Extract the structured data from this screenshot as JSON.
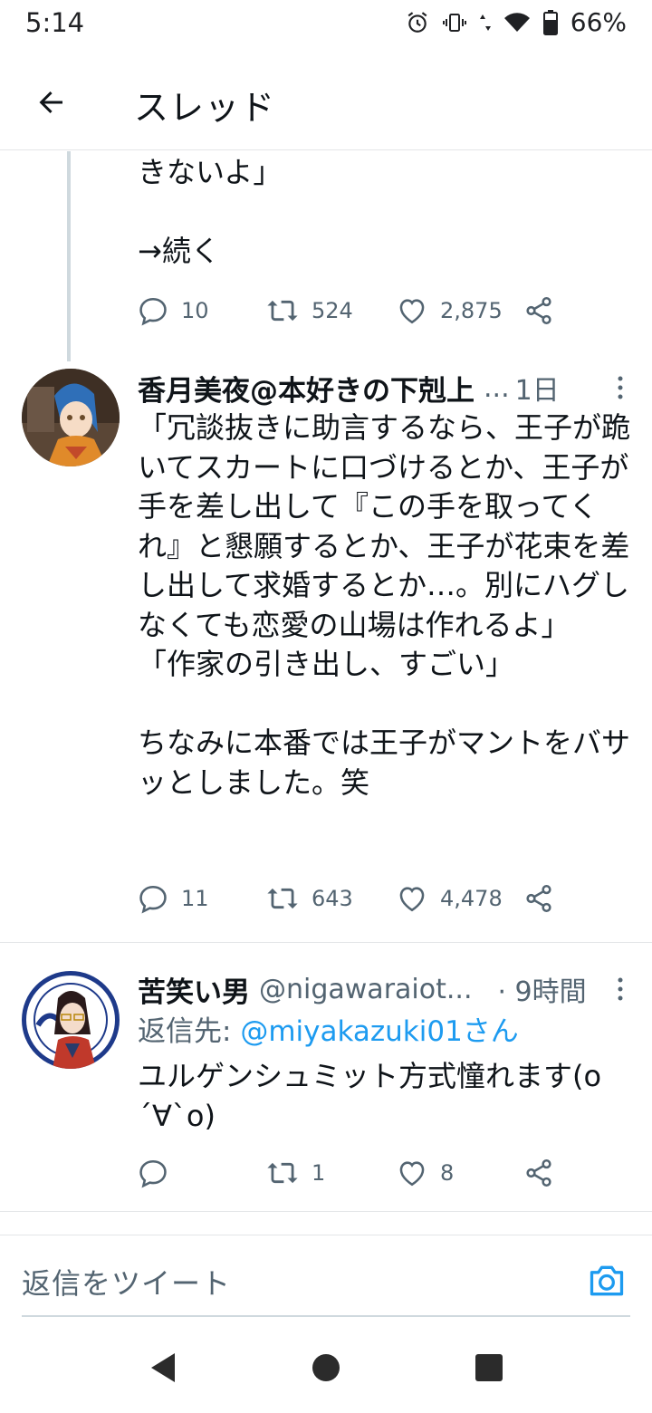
{
  "status_bar": {
    "time": "5:14",
    "battery": "66%",
    "icons": [
      "alarm-icon",
      "vibrate-icon",
      "data-arrows-icon",
      "wifi-icon",
      "battery-icon"
    ]
  },
  "header": {
    "title": "スレッド",
    "back_icon": "arrow-left-icon"
  },
  "tweets": [
    {
      "text": "きないよ」\n\n→続く",
      "replies": "10",
      "retweets": "524",
      "likes": "2,875"
    },
    {
      "display_name": "香月美夜@本好きの下剋上",
      "handle": "...",
      "time": "1日",
      "text": "「冗談抜きに助言するなら、王子が跪いてスカートに口づけるとか、王子が手を差し出して『この手を取ってくれ』と懇願するとか、王子が花束を差し出して求婚するとか…。別にハグしなくても恋愛の山場は作れるよ」\n「作家の引き出し、すごい」\n\nちなみに本番では王子がマントをバサッとしました。笑",
      "replies": "11",
      "retweets": "643",
      "likes": "4,478"
    },
    {
      "display_name": "苦笑い男",
      "handle": "@nigawaraiot...",
      "time": "· 9時間",
      "reply_to_label": "返信先: ",
      "reply_to_user": "@miyakazuki01さん",
      "text": "ユルゲンシュミット方式憧れます(o\n´∀`o)",
      "replies": "",
      "retweets": "1",
      "likes": "8"
    }
  ],
  "reply_bar": {
    "placeholder": "返信をツイート",
    "camera_icon": "camera-icon"
  },
  "nav_bar": {
    "buttons": [
      "back-triangle-icon",
      "home-circle-icon",
      "recents-square-icon"
    ]
  },
  "colors": {
    "text": "#0f1419",
    "secondary": "#536471",
    "link": "#1d9bf0",
    "divider": "#e4e6e8"
  }
}
